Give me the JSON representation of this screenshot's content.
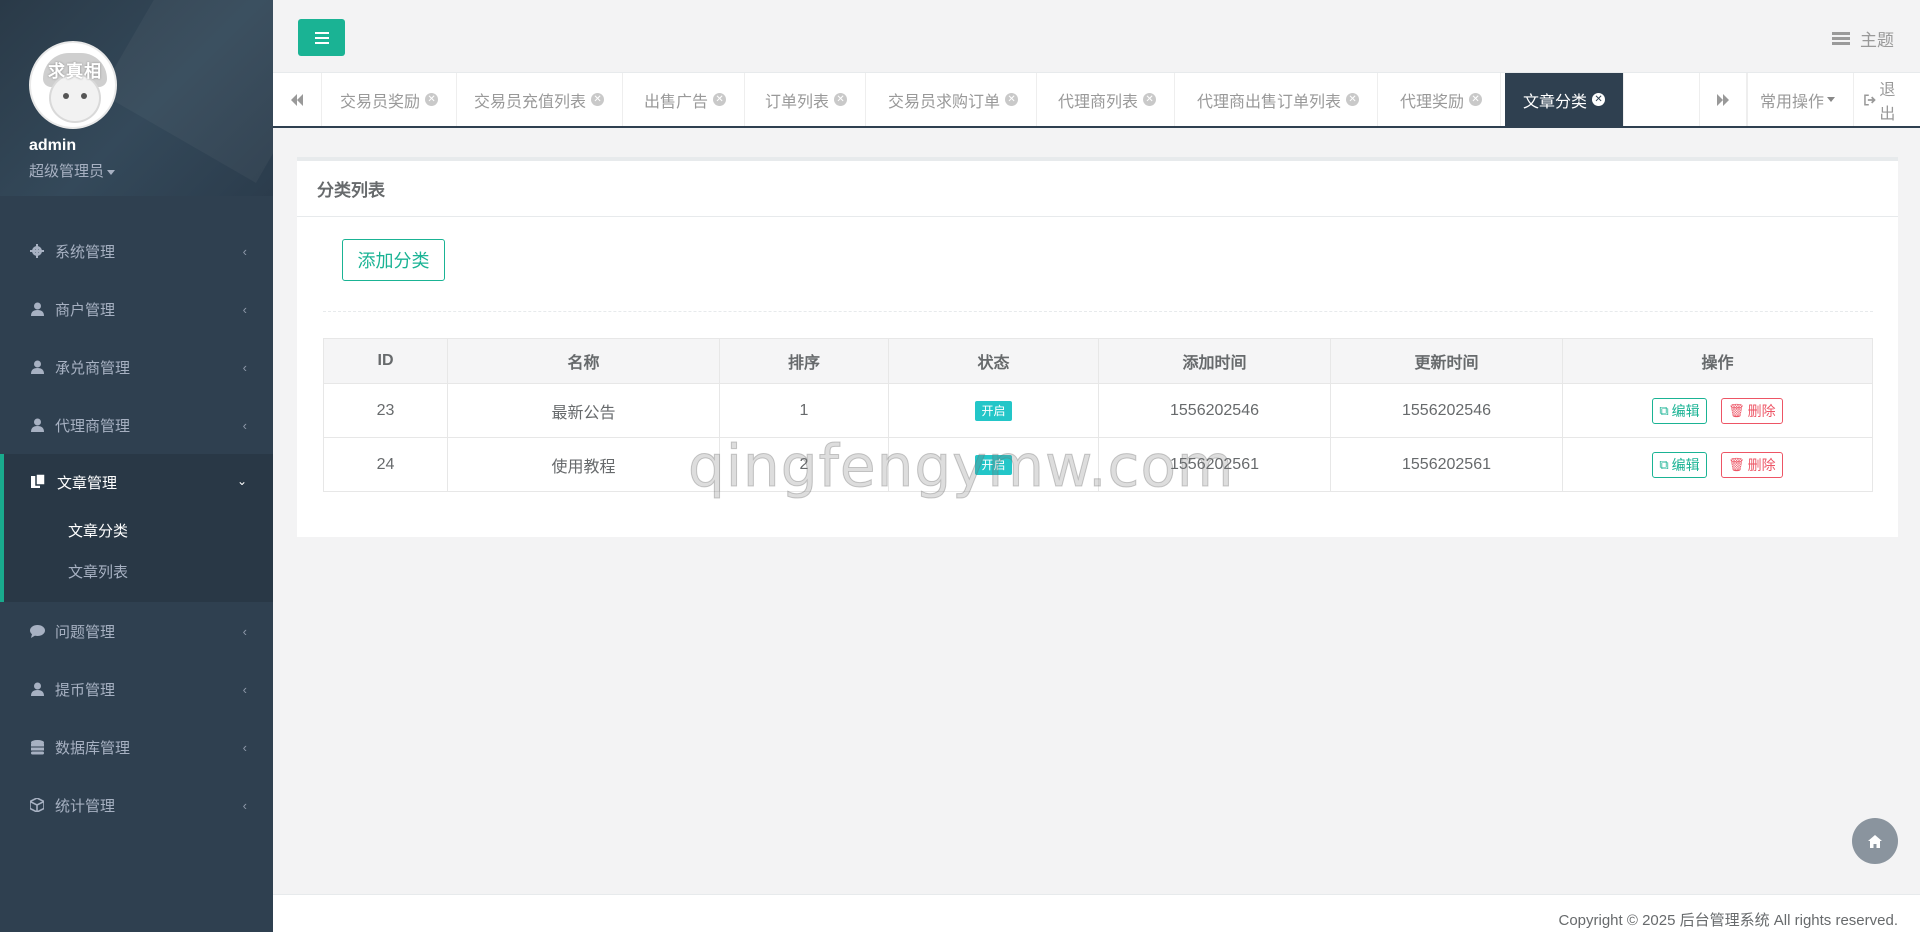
{
  "sidebar": {
    "avatar_text": "求真相",
    "username": "admin",
    "role": "超级管理员",
    "menu": [
      {
        "label": "系统管理",
        "icon": "gear-icon"
      },
      {
        "label": "商户管理",
        "icon": "user-icon"
      },
      {
        "label": "承兑商管理",
        "icon": "user-icon"
      },
      {
        "label": "代理商管理",
        "icon": "user-icon"
      },
      {
        "label": "文章管理",
        "icon": "copy-icon"
      },
      {
        "label": "问题管理",
        "icon": "comment-icon"
      },
      {
        "label": "提币管理",
        "icon": "user-icon"
      },
      {
        "label": "数据库管理",
        "icon": "database-icon"
      },
      {
        "label": "统计管理",
        "icon": "cube-icon"
      }
    ],
    "submenu": [
      {
        "label": "文章分类"
      },
      {
        "label": "文章列表"
      }
    ]
  },
  "topbar": {
    "theme_label": "主题"
  },
  "tabs": {
    "items": [
      {
        "label": "交易员奖励"
      },
      {
        "label": "交易员充值列表"
      },
      {
        "label": "出售广告"
      },
      {
        "label": "订单列表"
      },
      {
        "label": "交易员求购订单"
      },
      {
        "label": "代理商列表"
      },
      {
        "label": "代理商出售订单列表"
      },
      {
        "label": "代理奖励"
      },
      {
        "label": "文章分类"
      }
    ],
    "active_index": 8,
    "ops_label": "常用操作",
    "logout_label": "退出"
  },
  "panel": {
    "title": "分类列表",
    "add_button": "添加分类",
    "columns": [
      "ID",
      "名称",
      "排序",
      "状态",
      "添加时间",
      "更新时间",
      "操作"
    ],
    "rows": [
      {
        "id": "23",
        "name": "最新公告",
        "sort": "1",
        "status": "开启",
        "created": "1556202546",
        "updated": "1556202546",
        "edit": "编辑",
        "delete": "删除"
      },
      {
        "id": "24",
        "name": "使用教程",
        "sort": "2",
        "status": "开启",
        "created": "1556202561",
        "updated": "1556202561",
        "edit": "编辑",
        "delete": "删除"
      }
    ]
  },
  "watermark": "qingfengymw.com",
  "footer": "Copyright © 2025 后台管理系统 All rights reserved.",
  "colors": {
    "sidebar_bg": "#2f4050",
    "accent": "#1ab394",
    "status_badge": "#23c6c8",
    "danger": "#ed5565"
  }
}
